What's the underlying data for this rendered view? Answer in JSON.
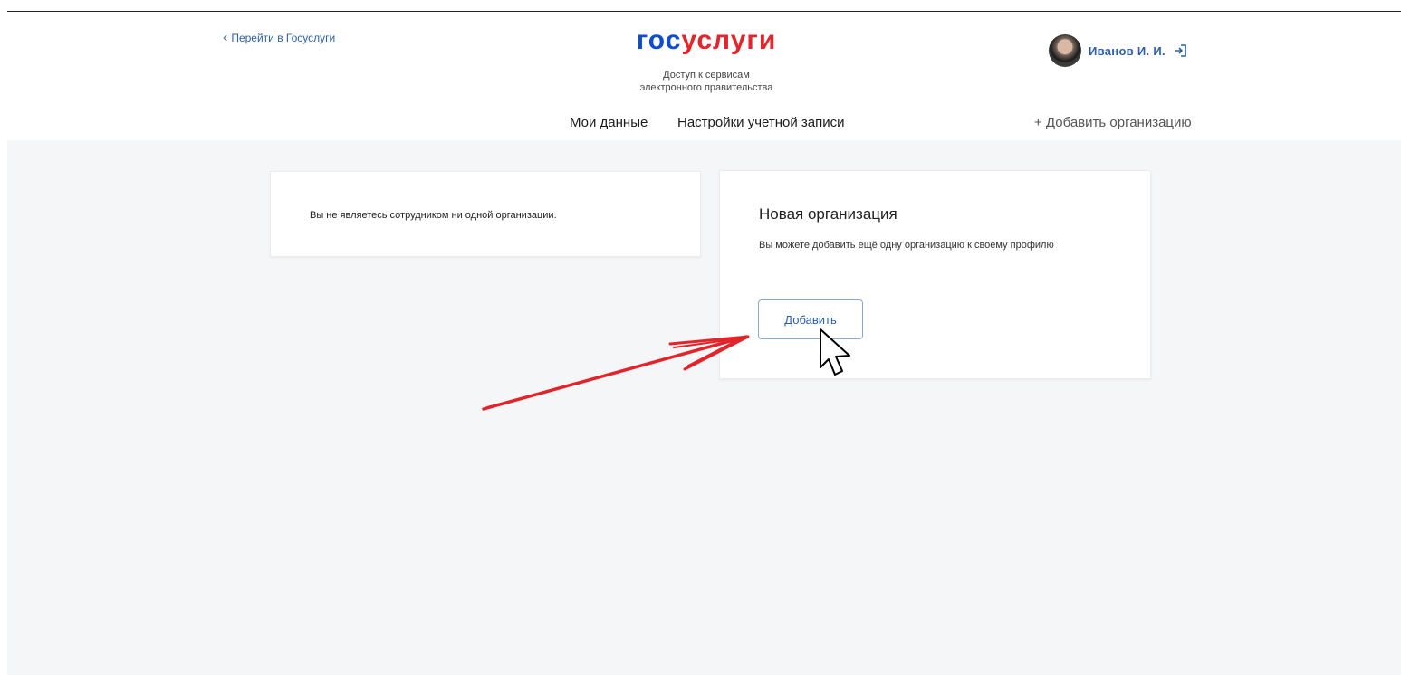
{
  "header": {
    "back_link": "Перейти в Госуслуги",
    "logo_part1": "гос",
    "logo_part2": "услуги",
    "subtitle_line1": "Доступ к сервисам",
    "subtitle_line2": "электронного правительства",
    "user_name": "Иванов  И. И.",
    "nav": {
      "my_data": "Мои данные",
      "account_settings": "Настройки учетной записи",
      "add_org": "+ Добавить организацию"
    }
  },
  "left_card": {
    "message": "Вы не являетесь сотрудником ни одной организации."
  },
  "right_card": {
    "title": "Новая организация",
    "description": "Вы можете добавить ещё одну организацию к своему профилю",
    "button": "Добавить"
  },
  "colors": {
    "brand_blue": "#0d4cd3",
    "brand_red": "#e3262e",
    "link_blue": "#2d5fa8",
    "arrow_red": "#e0252b"
  }
}
